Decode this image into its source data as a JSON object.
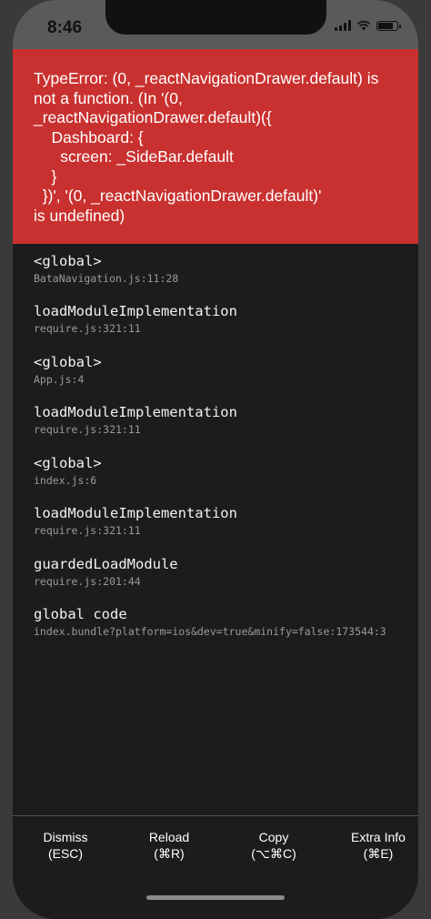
{
  "status_bar": {
    "time": "8:46",
    "icons": [
      "signal-icon",
      "wifi-icon",
      "battery-icon"
    ]
  },
  "error": {
    "message": "TypeError: (0, _reactNavigationDrawer.default) is\nnot a function. (In '(0,\n_reactNavigationDrawer.default)({\n    Dashboard: {\n      screen: _SideBar.default\n    }\n  })', '(0, _reactNavigationDrawer.default)'\nis undefined)",
    "background": "#c8312f"
  },
  "stack": [
    {
      "method": "<global>",
      "file": "BataNavigation.js:11:28"
    },
    {
      "method": "loadModuleImplementation",
      "file": "require.js:321:11"
    },
    {
      "method": "<global>",
      "file": "App.js:4"
    },
    {
      "method": "loadModuleImplementation",
      "file": "require.js:321:11"
    },
    {
      "method": "<global>",
      "file": "index.js:6"
    },
    {
      "method": "loadModuleImplementation",
      "file": "require.js:321:11"
    },
    {
      "method": "guardedLoadModule",
      "file": "require.js:201:44"
    },
    {
      "method": "global code",
      "file": "index.bundle?platform=ios&dev=true&minify=false:173544:3"
    }
  ],
  "footer": {
    "dismiss": {
      "label": "Dismiss",
      "shortcut": "(ESC)"
    },
    "reload": {
      "label": "Reload",
      "shortcut": "(⌘R)"
    },
    "copy": {
      "label": "Copy",
      "shortcut": "(⌥⌘C)"
    },
    "extra_info": {
      "label": "Extra Info",
      "shortcut": "(⌘E)"
    }
  }
}
